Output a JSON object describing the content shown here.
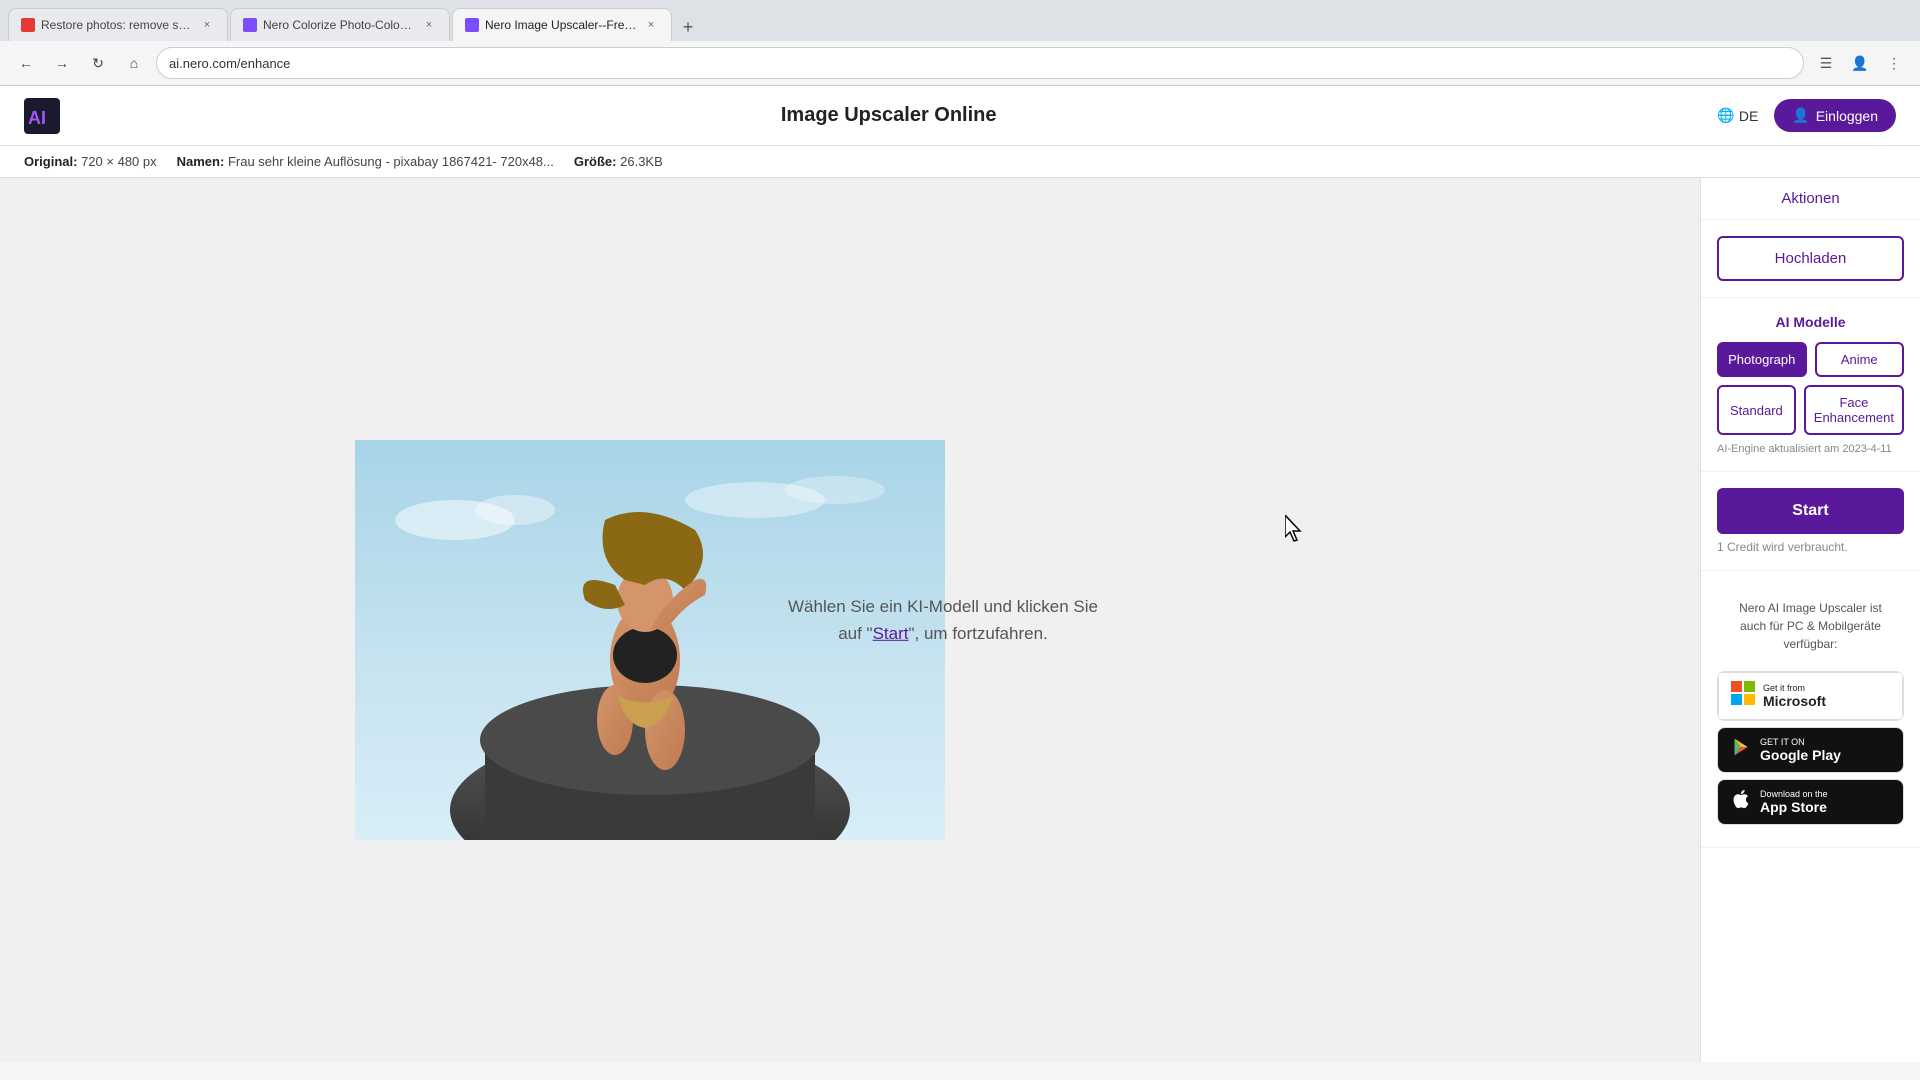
{
  "browser": {
    "tabs": [
      {
        "id": 1,
        "title": "Restore photos: remove scratch...",
        "active": false,
        "favicon_color": "#e53935"
      },
      {
        "id": 2,
        "title": "Nero Colorize Photo-Colorize Yo...",
        "active": false,
        "favicon_color": "#7c4dff"
      },
      {
        "id": 3,
        "title": "Nero Image Upscaler--Free Pho...",
        "active": true,
        "favicon_color": "#7c4dff"
      }
    ],
    "url": "ai.nero.com/enhance"
  },
  "header": {
    "logo_text": "AI",
    "title": "Image Upscaler Online",
    "lang": "DE",
    "login_label": "Einloggen"
  },
  "info_bar": {
    "original_label": "Original:",
    "original_value": "720 × 480 px",
    "name_label": "Namen:",
    "name_value": "Frau sehr kleine Auflösung - pixabay 1867421- 720x48...",
    "size_label": "Größe:",
    "size_value": "26.3KB"
  },
  "sidebar": {
    "aktionen_label": "Aktionen",
    "upload_btn_label": "Hochladen",
    "ai_models_label": "AI Modelle",
    "model_btn_1": "Photograph",
    "model_btn_2": "Anime",
    "model_btn_3": "Standard",
    "model_btn_4": "Face Enhancement",
    "ai_engine_note": "AI-Engine aktualisiert am 2023-4-11",
    "start_btn_label": "Start",
    "credit_note": "1 Credit wird verbraucht.",
    "mobile_promo": "Nero AI Image Upscaler ist auch für PC & Mobilgeräte verfügbar:",
    "microsoft_store_small": "Get it from",
    "microsoft_store_large": "Microsoft",
    "google_play_small": "GET IT ON",
    "google_play_large": "Google Play",
    "app_store_small": "Download on the",
    "app_store_large": "App Store"
  },
  "center_message": {
    "line1": "Wählen Sie ein KI-Modell und klicken Sie",
    "line2_prefix": "auf \"",
    "link_text": "Start",
    "line2_suffix": "\", um fortzufahren."
  }
}
